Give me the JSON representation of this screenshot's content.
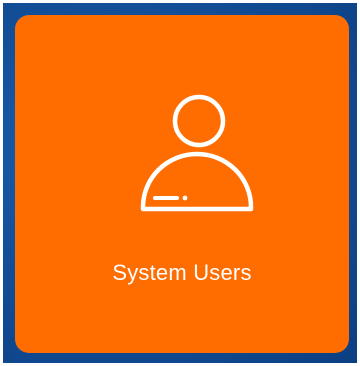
{
  "tile": {
    "label": "System Users",
    "icon": "user-icon",
    "colors": {
      "tile": "#ff6d00",
      "backdrop": "#134f99",
      "icon": "#ffffff",
      "text": "#ffffff"
    }
  }
}
